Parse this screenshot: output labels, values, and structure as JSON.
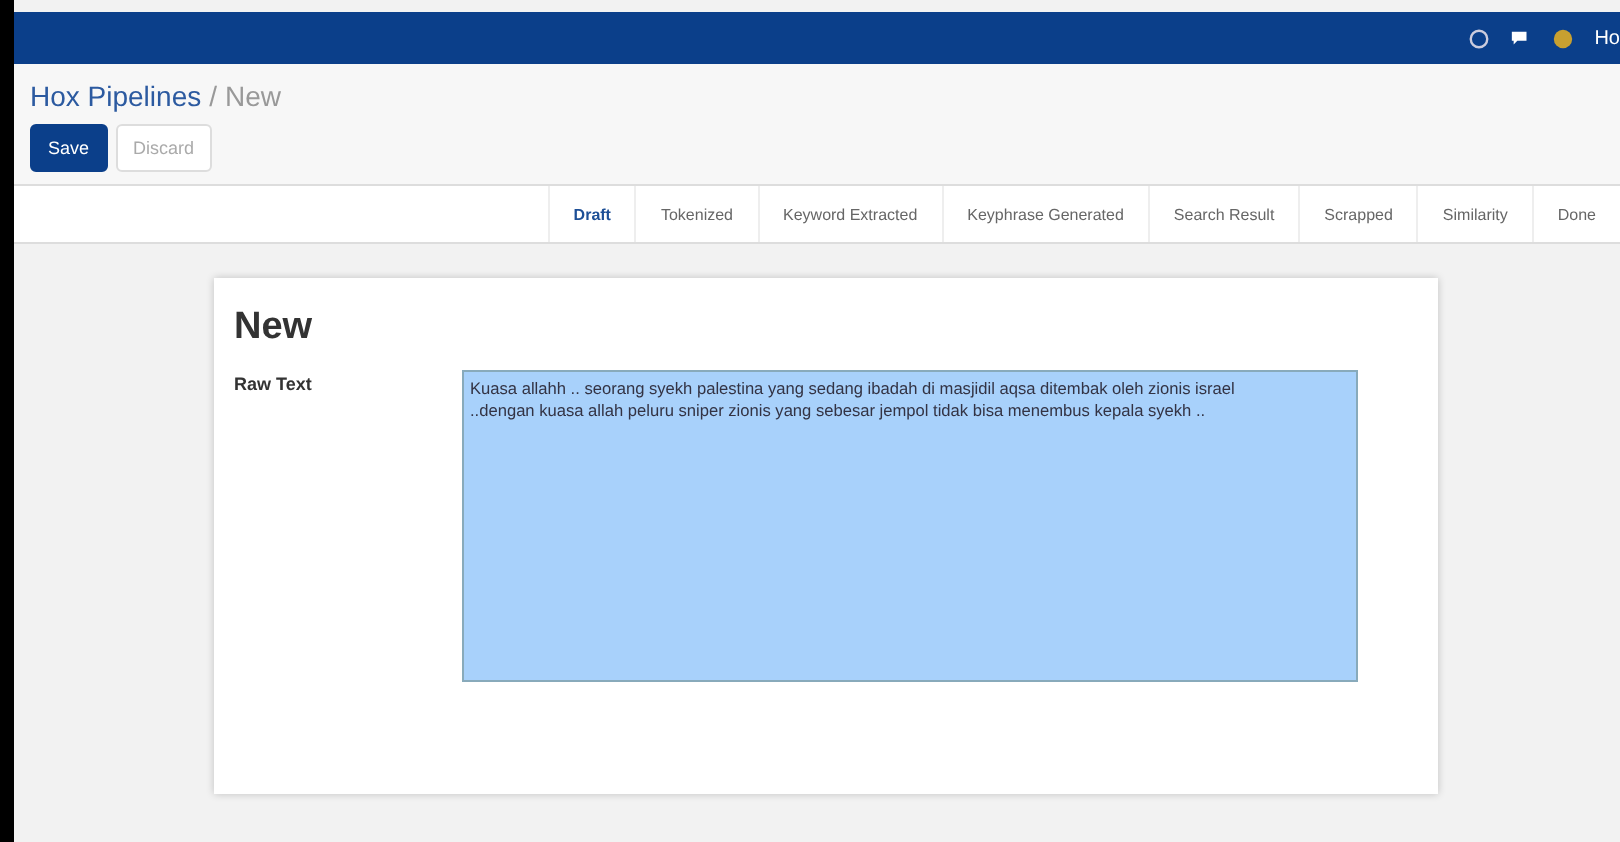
{
  "navbar": {
    "user": "Ho"
  },
  "breadcrumb": {
    "parent": "Hox Pipelines",
    "separator": "/",
    "current": "New"
  },
  "buttons": [
    {
      "label": "Save",
      "kind": "primary"
    },
    {
      "label": "Discard",
      "kind": "secondary"
    }
  ],
  "statusbar": [
    {
      "label": "Draft",
      "selected": true
    },
    {
      "label": "Tokenized",
      "selected": false
    },
    {
      "label": "Keyword Extracted",
      "selected": false
    },
    {
      "label": "Keyphrase Generated",
      "selected": false
    },
    {
      "label": "Search Result",
      "selected": false
    },
    {
      "label": "Scrapped",
      "selected": false
    },
    {
      "label": "Similarity",
      "selected": false
    },
    {
      "label": "Done",
      "selected": false
    }
  ],
  "form": {
    "title": "New",
    "field_label": "Raw Text",
    "value": "Kuasa allahh .. seorang syekh palestina yang sedang ibadah di masjidil aqsa ditembak oleh zionis israel\n..dengan kuasa allah peluru sniper zionis yang sebesar jempol tidak bisa menembus kepala syekh ..",
    "selected": true
  }
}
